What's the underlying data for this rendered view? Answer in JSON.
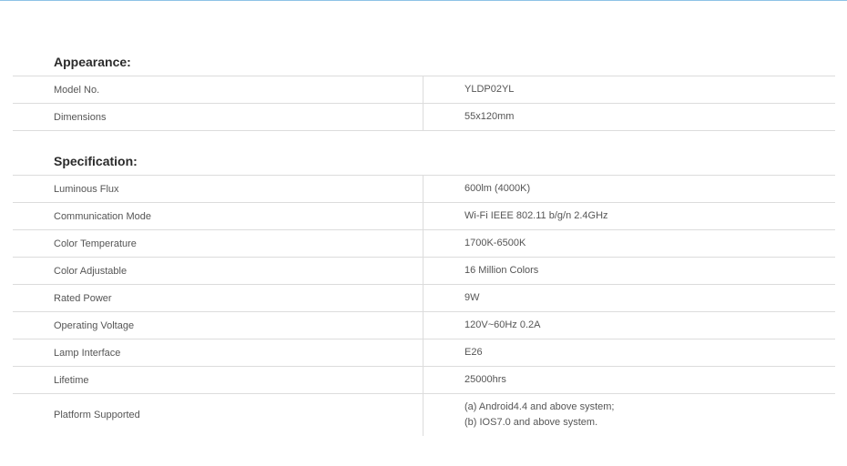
{
  "appearance": {
    "title": "Appearance:",
    "rows": [
      {
        "label": "Model No.",
        "value": "YLDP02YL"
      },
      {
        "label": "Dimensions",
        "value": "55x120mm"
      }
    ]
  },
  "specification": {
    "title": "Specification:",
    "rows": [
      {
        "label": "Luminous Flux",
        "value": "600lm (4000K)"
      },
      {
        "label": "Communication Mode",
        "value": "Wi-Fi IEEE 802.11 b/g/n 2.4GHz"
      },
      {
        "label": "Color Temperature",
        "value": "1700K-6500K"
      },
      {
        "label": "Color Adjustable",
        "value": "16 Million Colors"
      },
      {
        "label": "Rated Power",
        "value": "9W"
      },
      {
        "label": "Operating Voltage",
        "value": "120V~60Hz 0.2A"
      },
      {
        "label": "Lamp Interface",
        "value": "E26"
      },
      {
        "label": "Lifetime",
        "value": "25000hrs"
      }
    ],
    "platform": {
      "label": "Platform Supported",
      "line1": "(a) Android4.4 and above system;",
      "line2": "(b) IOS7.0 and above system."
    }
  }
}
